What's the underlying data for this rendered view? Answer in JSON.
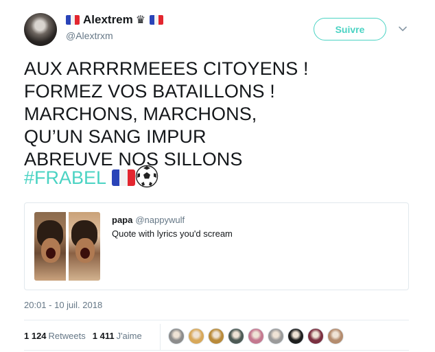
{
  "author": {
    "name": "Alextrem",
    "crown_glyph": "♛",
    "handle": "@Alextrxm"
  },
  "follow_button": {
    "label": "Suivre"
  },
  "tweet": {
    "lines": [
      "AUX ARRRRMEEES CITOYENS !",
      "FORMEZ VOS BATAILLONS !",
      "MARCHONS, MARCHONS,",
      "QU’UN SANG IMPUR",
      "ABREUVE NOS SILLONS"
    ],
    "hashtag": "#FRABEL"
  },
  "quote": {
    "name": "papa",
    "handle": "@nappywulf",
    "text": "Quote with lyrics you'd scream"
  },
  "timestamp": "20:01 - 10 juil. 2018",
  "stats": {
    "retweets_count": "1 124",
    "retweets_label": "Retweets",
    "likes_count": "1 411",
    "likes_label": "J'aime"
  },
  "liker_avatars": [
    "#8c8c8c",
    "#d8a85a",
    "#b98a3a",
    "#4d5a55",
    "#c4788f",
    "#9a9a9a",
    "#1e1e1e",
    "#7b3040",
    "#b48c6e"
  ],
  "colors": {
    "accent": "#4ad3c3",
    "secondary_text": "#657786",
    "primary_text": "#14171a"
  },
  "icons": {
    "author_flags": "france-flag-icon",
    "hashtag_emojis": [
      "france-flag-icon",
      "soccer-ball-icon"
    ],
    "menu": "chevron-down-icon"
  }
}
